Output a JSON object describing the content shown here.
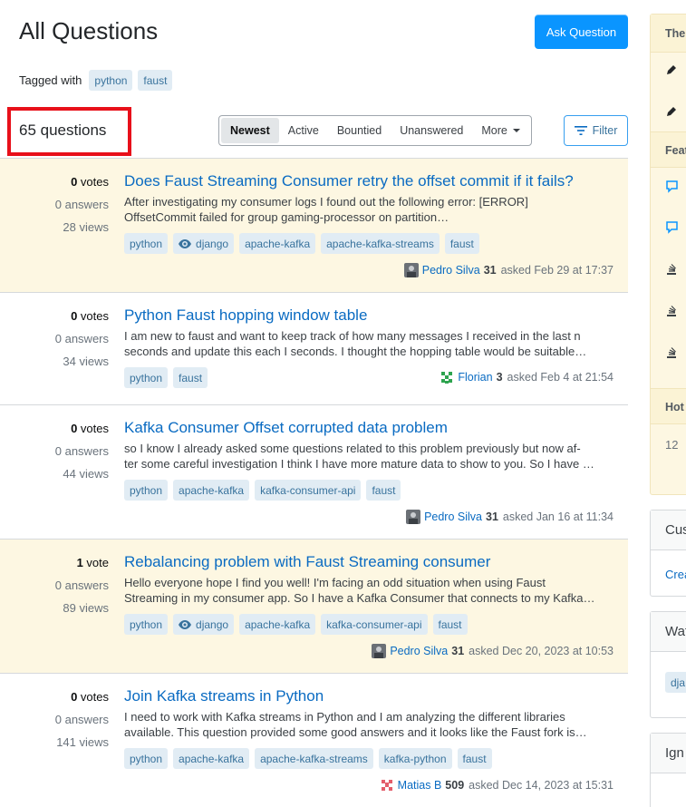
{
  "page": {
    "title": "All Questions",
    "ask_button": "Ask Question",
    "tagged_with_label": "Tagged with",
    "tagged_tags": [
      "python",
      "faust"
    ],
    "question_count": "65 questions",
    "highlight_color": "#e8101a",
    "accent_color": "#0a95ff"
  },
  "tabs": [
    {
      "label": "Newest",
      "active": true
    },
    {
      "label": "Active",
      "active": false
    },
    {
      "label": "Bountied",
      "active": false
    },
    {
      "label": "Unanswered",
      "active": false
    },
    {
      "label": "More",
      "active": false
    }
  ],
  "filter_button": "Filter",
  "questions": [
    {
      "votes_num": "0",
      "votes_word": "votes",
      "answers": "0 answers",
      "views": "28 views",
      "title": "Does Faust Streaming Consumer retry the offset commit if it fails?",
      "excerpt_1": "After investigating my consumer logs I found out the following error: [ERROR]",
      "excerpt_2": "OffsetCommit failed for group gaming-processor on partition…",
      "tags": [
        "python",
        "django",
        "apache-kafka",
        "apache-kafka-streams",
        "faust"
      ],
      "watched_tags": [
        "django"
      ],
      "user": "Pedro Silva",
      "rep": "31",
      "asked": "asked Feb 29 at 17:37",
      "highlighted": true
    },
    {
      "votes_num": "0",
      "votes_word": "votes",
      "answers": "0 answers",
      "views": "34 views",
      "title": "Python Faust hopping window table",
      "excerpt_1": "I am new to faust and want to keep track of how many messages I received in the last n",
      "excerpt_2": "seconds and update this each I seconds. I thought the hopping table would be suitable…",
      "tags": [
        "python",
        "faust"
      ],
      "watched_tags": [],
      "user": "Florian",
      "rep": "3",
      "asked": "asked Feb 4 at 21:54",
      "highlighted": false
    },
    {
      "votes_num": "0",
      "votes_word": "votes",
      "answers": "0 answers",
      "views": "44 views",
      "title": "Kafka Consumer Offset corrupted data problem",
      "excerpt_1": "so I know I already asked some questions related to this problem previously but now af-",
      "excerpt_2": "ter some careful investigation I think I have more mature data to show to you. So I have …",
      "tags": [
        "python",
        "apache-kafka",
        "kafka-consumer-api",
        "faust"
      ],
      "watched_tags": [],
      "user": "Pedro Silva",
      "rep": "31",
      "asked": "asked Jan 16 at 11:34",
      "highlighted": false
    },
    {
      "votes_num": "1",
      "votes_word": "vote",
      "answers": "0 answers",
      "views": "89 views",
      "title": "Rebalancing problem with Faust Streaming consumer",
      "excerpt_1": "Hello everyone hope I find you well! I'm facing an odd situation when using Faust",
      "excerpt_2": "Streaming in my consumer app. So I have a Kafka Consumer that connects to my Kafka…",
      "tags": [
        "python",
        "django",
        "apache-kafka",
        "kafka-consumer-api",
        "faust"
      ],
      "watched_tags": [
        "django"
      ],
      "user": "Pedro Silva",
      "rep": "31",
      "asked": "asked Dec 20, 2023 at 10:53",
      "highlighted": true
    },
    {
      "votes_num": "0",
      "votes_word": "votes",
      "answers": "0 answers",
      "views": "141 views",
      "title": "Join Kafka streams in Python",
      "excerpt_1": "I need to work with Kafka streams in Python and I am analyzing the different libraries",
      "excerpt_2": "available. This question provided some good answers and it looks like the Faust fork is…",
      "tags": [
        "python",
        "apache-kafka",
        "apache-kafka-streams",
        "kafka-python",
        "faust"
      ],
      "watched_tags": [],
      "user": "Matias B",
      "rep": "509",
      "asked": "asked Dec 14, 2023 at 15:31",
      "highlighted": false
    }
  ],
  "sidebar": {
    "blog_header": "The",
    "featured_header": "Feat",
    "hot_header": "Hot",
    "hot_count": "12",
    "custom_header": "Cus",
    "custom_link": "Crea",
    "watched_header": "Wat",
    "watched_tag": "dja",
    "ignored_header": "Ign"
  }
}
